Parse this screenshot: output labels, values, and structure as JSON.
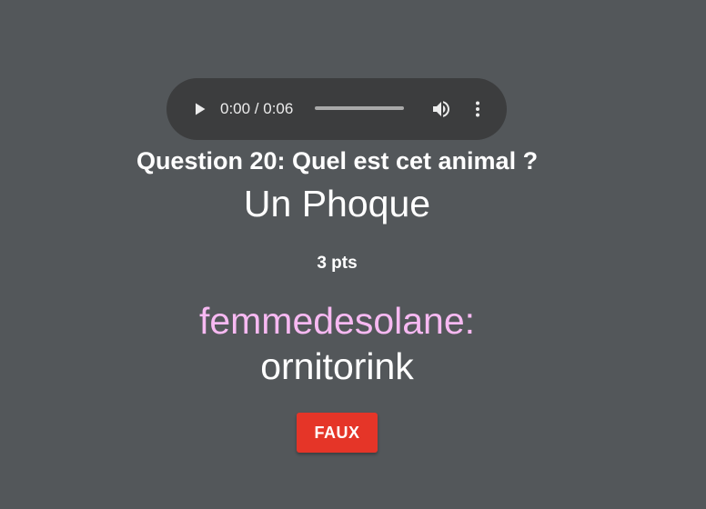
{
  "audio": {
    "time_display": "0:00 / 0:06",
    "progress_fraction": 0,
    "icons": {
      "play": "play-icon",
      "volume": "volume-icon",
      "more": "more-vert-icon"
    }
  },
  "question": {
    "text": "Question 20: Quel est cet animal ?",
    "answer": "Un Phoque",
    "points": "3 pts"
  },
  "response": {
    "player_name": "femmedesolane:",
    "player_answer": "ornitorink",
    "verdict_label": "FAUX"
  },
  "colors": {
    "background": "#53575a",
    "player_name": "#f7b9f2",
    "verdict": "#e53528",
    "audio_bg": "#3c3d3e"
  }
}
